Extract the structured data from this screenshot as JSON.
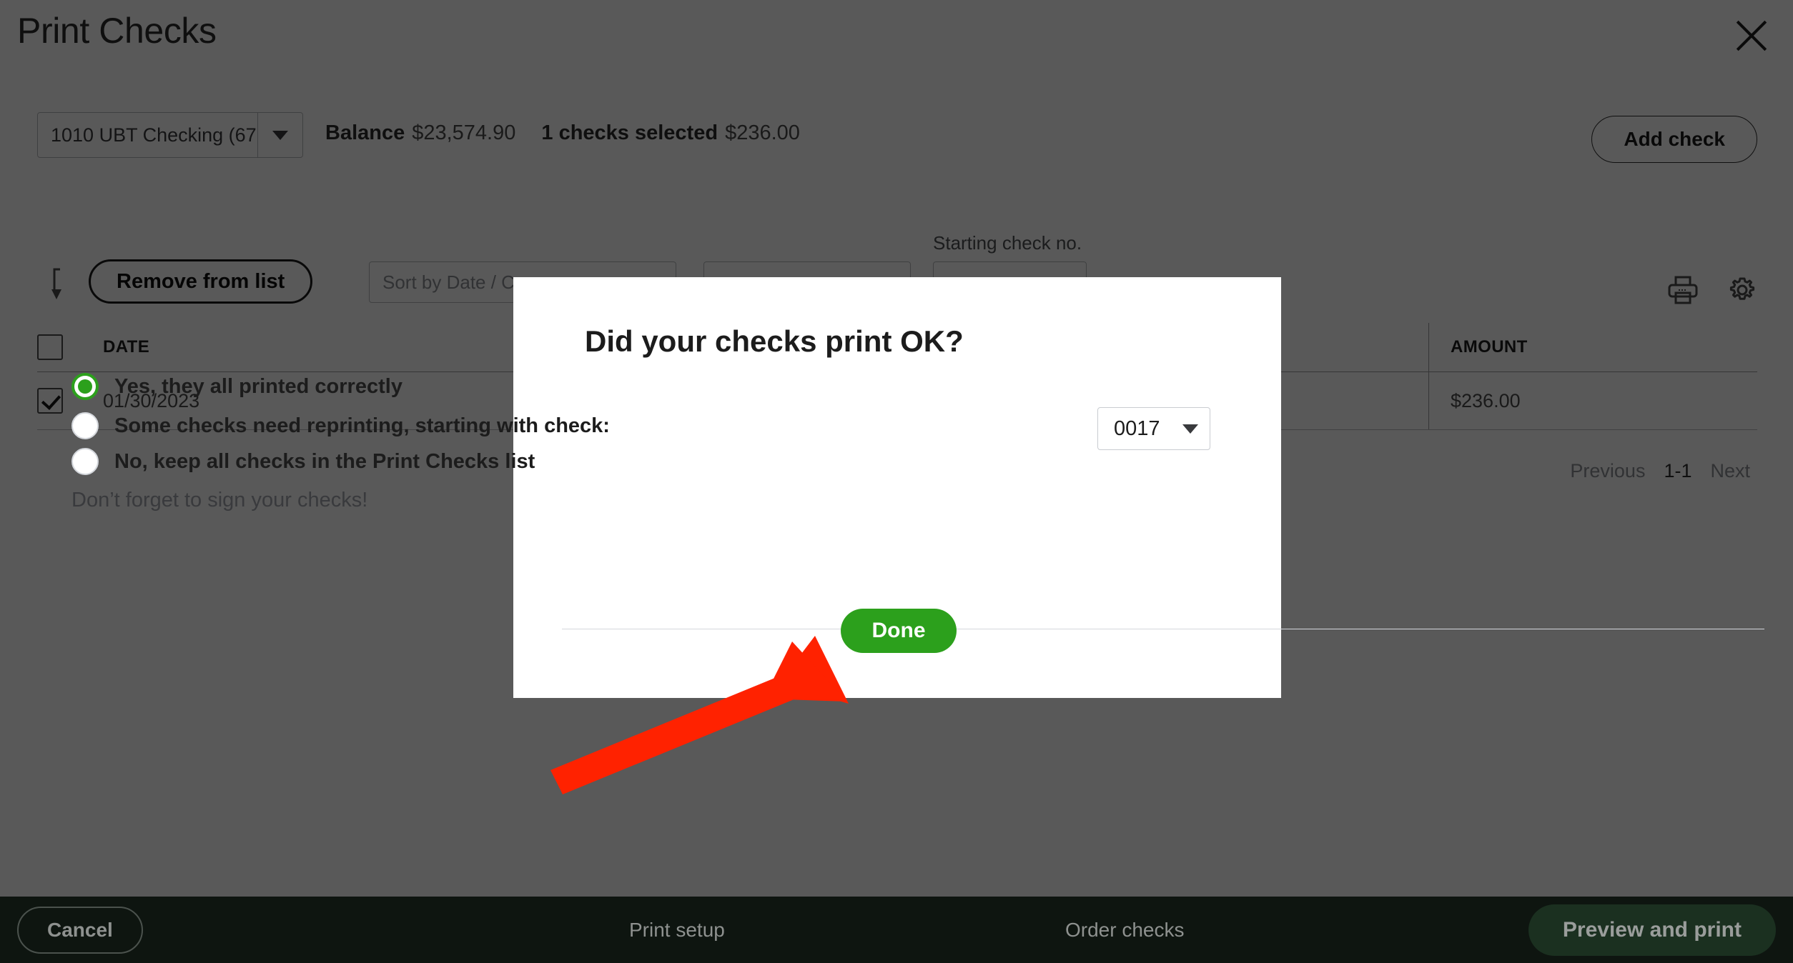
{
  "header": {
    "title": "Print Checks",
    "close_icon": "close-icon"
  },
  "account_bar": {
    "account_value": "1010 UBT Checking (67",
    "balance_label": "Balance",
    "balance_amount": "$23,574.90",
    "selected_label": "1 checks selected",
    "selected_amount": "$236.00",
    "add_check_label": "Add check"
  },
  "toolbar": {
    "batch_icon": "batch-action-icon",
    "remove_label": "Remove from list",
    "sort_placeholder": "Sort by Date / C",
    "filter_placeholder": "",
    "starting_check_label": "Starting check no.",
    "starting_check_value": "",
    "print_icon": "printer-icon",
    "settings_icon": "gear-icon"
  },
  "table": {
    "columns": [
      "DATE",
      "AMOUNT"
    ],
    "rows": [
      {
        "checked": true,
        "date": "01/30/2023",
        "amount": "$236.00"
      }
    ]
  },
  "pagination": {
    "previous": "Previous",
    "range": "1-1",
    "next": "Next"
  },
  "bottom_bar": {
    "cancel": "Cancel",
    "print_setup": "Print setup",
    "order_checks": "Order checks",
    "preview_and_print": "Preview and print"
  },
  "modal": {
    "title": "Did your checks print OK?",
    "options": [
      {
        "label": "Yes, they all printed correctly",
        "selected": true
      },
      {
        "label": "Some checks need reprinting, starting with check:",
        "selected": false
      },
      {
        "label": "No, keep all checks in the Print Checks list",
        "selected": false
      }
    ],
    "check_number": "0017",
    "note": "Don’t forget to sign your checks!",
    "done_label": "Done"
  },
  "annotation": {
    "arrow_color": "#FF2200",
    "arrow_target": "Done"
  },
  "colors": {
    "brand_green": "#2ca01c",
    "overlay": "rgba(0,0,0,0.65)",
    "bottom_bar": "#0e1510",
    "annotation_red": "#FF2200"
  }
}
